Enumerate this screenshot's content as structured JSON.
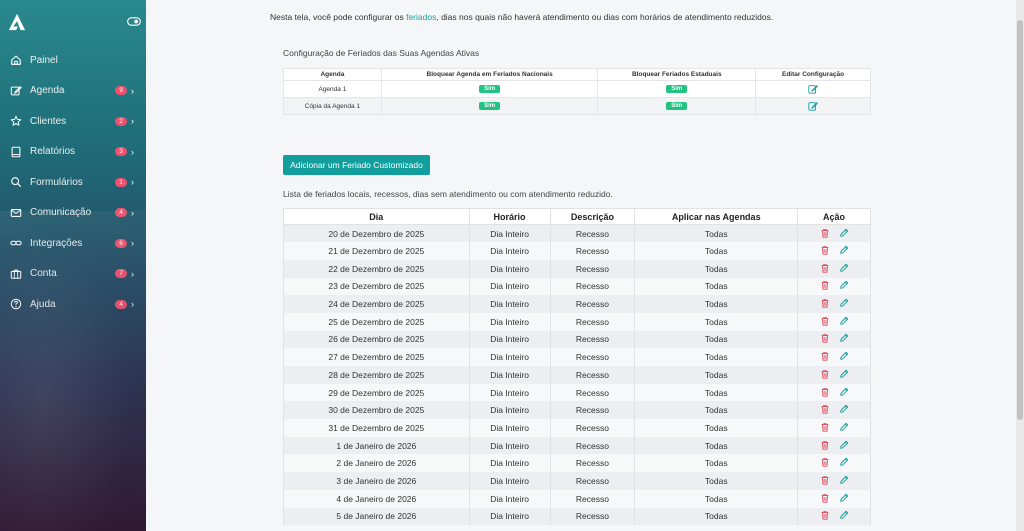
{
  "sidebar": {
    "items": [
      {
        "label": "Painel",
        "icon": "home-icon",
        "badge": null
      },
      {
        "label": "Agenda",
        "icon": "edit-icon",
        "badge": "9"
      },
      {
        "label": "Clientes",
        "icon": "star-icon",
        "badge": "2"
      },
      {
        "label": "Relatórios",
        "icon": "book-icon",
        "badge": "3"
      },
      {
        "label": "Formulários",
        "icon": "search-icon",
        "badge": "1"
      },
      {
        "label": "Comunicação",
        "icon": "mail-icon",
        "badge": "4"
      },
      {
        "label": "Integrações",
        "icon": "link-icon",
        "badge": "6"
      },
      {
        "label": "Conta",
        "icon": "briefcase-icon",
        "badge": "7"
      },
      {
        "label": "Ajuda",
        "icon": "help-icon",
        "badge": "4"
      }
    ]
  },
  "intro": {
    "prefix": "Nesta tela, você pode configurar os ",
    "link": "feriados",
    "suffix": ", dias nos quais não haverá atendimento ou dias com horários de atendimento reduzidos."
  },
  "config": {
    "title": "Configuração de Feriados das Suas Agendas Ativas",
    "headers": [
      "Agenda",
      "Bloquear Agenda em Feriados Nacionais",
      "Bloquear Feriados Estaduais",
      "Editar Configuração"
    ],
    "rows": [
      {
        "agenda": "Agenda 1",
        "nacionais": "Sim",
        "estaduais": "Sim"
      },
      {
        "agenda": "Cópia da Agenda 1",
        "nacionais": "Sim",
        "estaduais": "Sim"
      }
    ]
  },
  "add_button": "Adicionar um Feriado Customizado",
  "holidays": {
    "title": "Lista de feriados locais, recessos, dias sem atendimento ou com atendimento reduzido.",
    "headers": [
      "Dia",
      "Horário",
      "Descrição",
      "Aplicar nas Agendas",
      "Ação"
    ],
    "rows": [
      {
        "dia": "20 de Dezembro de 2025",
        "horario": "Dia Inteiro",
        "descricao": "Recesso",
        "agendas": "Todas"
      },
      {
        "dia": "21 de Dezembro de 2025",
        "horario": "Dia Inteiro",
        "descricao": "Recesso",
        "agendas": "Todas"
      },
      {
        "dia": "22 de Dezembro de 2025",
        "horario": "Dia Inteiro",
        "descricao": "Recesso",
        "agendas": "Todas"
      },
      {
        "dia": "23 de Dezembro de 2025",
        "horario": "Dia Inteiro",
        "descricao": "Recesso",
        "agendas": "Todas"
      },
      {
        "dia": "24 de Dezembro de 2025",
        "horario": "Dia Inteiro",
        "descricao": "Recesso",
        "agendas": "Todas"
      },
      {
        "dia": "25 de Dezembro de 2025",
        "horario": "Dia Inteiro",
        "descricao": "Recesso",
        "agendas": "Todas"
      },
      {
        "dia": "26 de Dezembro de 2025",
        "horario": "Dia Inteiro",
        "descricao": "Recesso",
        "agendas": "Todas"
      },
      {
        "dia": "27 de Dezembro de 2025",
        "horario": "Dia Inteiro",
        "descricao": "Recesso",
        "agendas": "Todas"
      },
      {
        "dia": "28 de Dezembro de 2025",
        "horario": "Dia Inteiro",
        "descricao": "Recesso",
        "agendas": "Todas"
      },
      {
        "dia": "29 de Dezembro de 2025",
        "horario": "Dia Inteiro",
        "descricao": "Recesso",
        "agendas": "Todas"
      },
      {
        "dia": "30 de Dezembro de 2025",
        "horario": "Dia Inteiro",
        "descricao": "Recesso",
        "agendas": "Todas"
      },
      {
        "dia": "31 de Dezembro de 2025",
        "horario": "Dia Inteiro",
        "descricao": "Recesso",
        "agendas": "Todas"
      },
      {
        "dia": "1 de Janeiro de 2026",
        "horario": "Dia Inteiro",
        "descricao": "Recesso",
        "agendas": "Todas"
      },
      {
        "dia": "2 de Janeiro de 2026",
        "horario": "Dia Inteiro",
        "descricao": "Recesso",
        "agendas": "Todas"
      },
      {
        "dia": "3 de Janeiro de 2026",
        "horario": "Dia Inteiro",
        "descricao": "Recesso",
        "agendas": "Todas"
      },
      {
        "dia": "4 de Janeiro de 2026",
        "horario": "Dia Inteiro",
        "descricao": "Recesso",
        "agendas": "Todas"
      },
      {
        "dia": "5 de Janeiro de 2026",
        "horario": "Dia Inteiro",
        "descricao": "Recesso",
        "agendas": "Todas"
      }
    ]
  },
  "colors": {
    "accent": "#129e9c",
    "badge": "#f0506e",
    "yes": "#22c283",
    "delete": "#e0485b"
  }
}
